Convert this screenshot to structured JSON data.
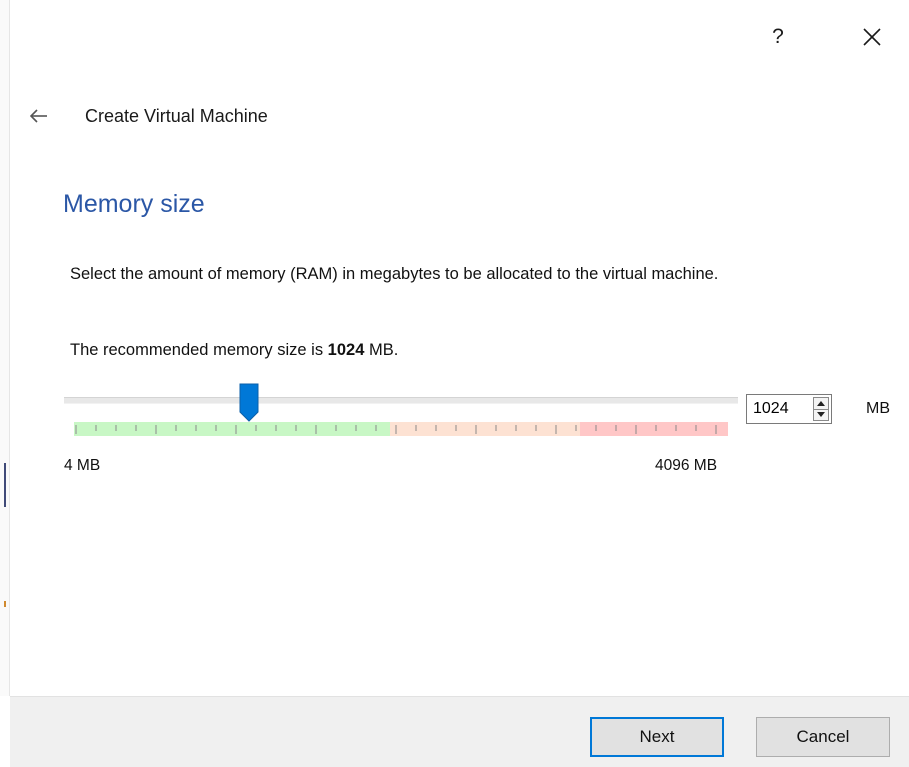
{
  "titlebar": {
    "help_label": "?",
    "close_icon": "close-icon"
  },
  "header": {
    "back_icon": "arrow-left-icon",
    "title": "Create Virtual Machine"
  },
  "page": {
    "title": "Memory size",
    "description": "Select the amount of memory (RAM) in megabytes to be allocated to the virtual machine.",
    "recommend_prefix": "The recommended memory size is ",
    "recommend_value": "1024",
    "recommend_suffix": " MB."
  },
  "memory_slider": {
    "min_label": "4 MB",
    "max_label": "4096 MB",
    "min_value": 4,
    "max_value": 4096,
    "value": 1024,
    "zones": [
      {
        "name": "safe",
        "color": "#c8f7c5"
      },
      {
        "name": "warning",
        "color": "#fde2d3"
      },
      {
        "name": "danger",
        "color": "#ffc7c7"
      }
    ],
    "handle_color": "#0078d7"
  },
  "memory_spinbox": {
    "value": "1024",
    "unit": "MB"
  },
  "footer": {
    "next_label": "Next",
    "cancel_label": "Cancel",
    "default_button_color": "#0078d7"
  },
  "colors": {
    "accent_title": "#2b57a6"
  }
}
